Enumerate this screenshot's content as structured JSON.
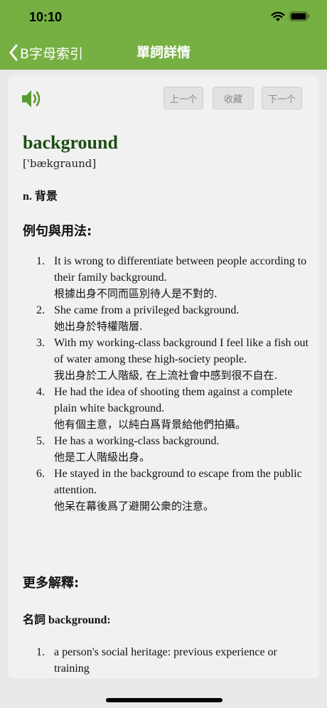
{
  "status": {
    "time": "10:10"
  },
  "nav": {
    "back_label": "B字母索引",
    "title": "單詞詳情"
  },
  "toolbar": {
    "prev_label": "上一个",
    "fav_label": "收藏",
    "next_label": "下一个"
  },
  "entry": {
    "word": "background",
    "phonetic": "['bækgraund]",
    "pos": "n. 背景",
    "examples_heading": "例句與用法:",
    "examples": [
      {
        "num": "1.",
        "en": "It is wrong to differentiate between people according to their family background.",
        "zh": "根據出身不同而區別待人是不對的."
      },
      {
        "num": "2.",
        "en": "She came from a privileged background.",
        "zh": "她出身於特權階層."
      },
      {
        "num": "3.",
        "en": "With my working-class background I feel like a fish out of water among these high-society people.",
        "zh": "我出身於工人階級, 在上流社會中感到很不自在."
      },
      {
        "num": "4.",
        "en": "He had the idea of shooting them against a complete plain white background.",
        "zh": "他有個主意，以純白爲背景給他們拍攝。"
      },
      {
        "num": "5.",
        "en": "He has a working-class background.",
        "zh": "他是工人階級出身。"
      },
      {
        "num": "6.",
        "en": "He stayed in the background to escape from the public attention.",
        "zh": "他呆在幕後爲了避開公衆的注意。"
      }
    ],
    "more_heading": "更多解釋:",
    "noun_heading": "名詞 background:",
    "definitions": [
      {
        "num": "1.",
        "text": "a person's social heritage: previous experience or training"
      }
    ]
  },
  "icons": {
    "speaker": "speaker-icon",
    "back": "chevron-left-icon",
    "wifi": "wifi-icon",
    "battery": "battery-icon"
  },
  "colors": {
    "accent": "#76b043",
    "word": "#1d4d12"
  }
}
